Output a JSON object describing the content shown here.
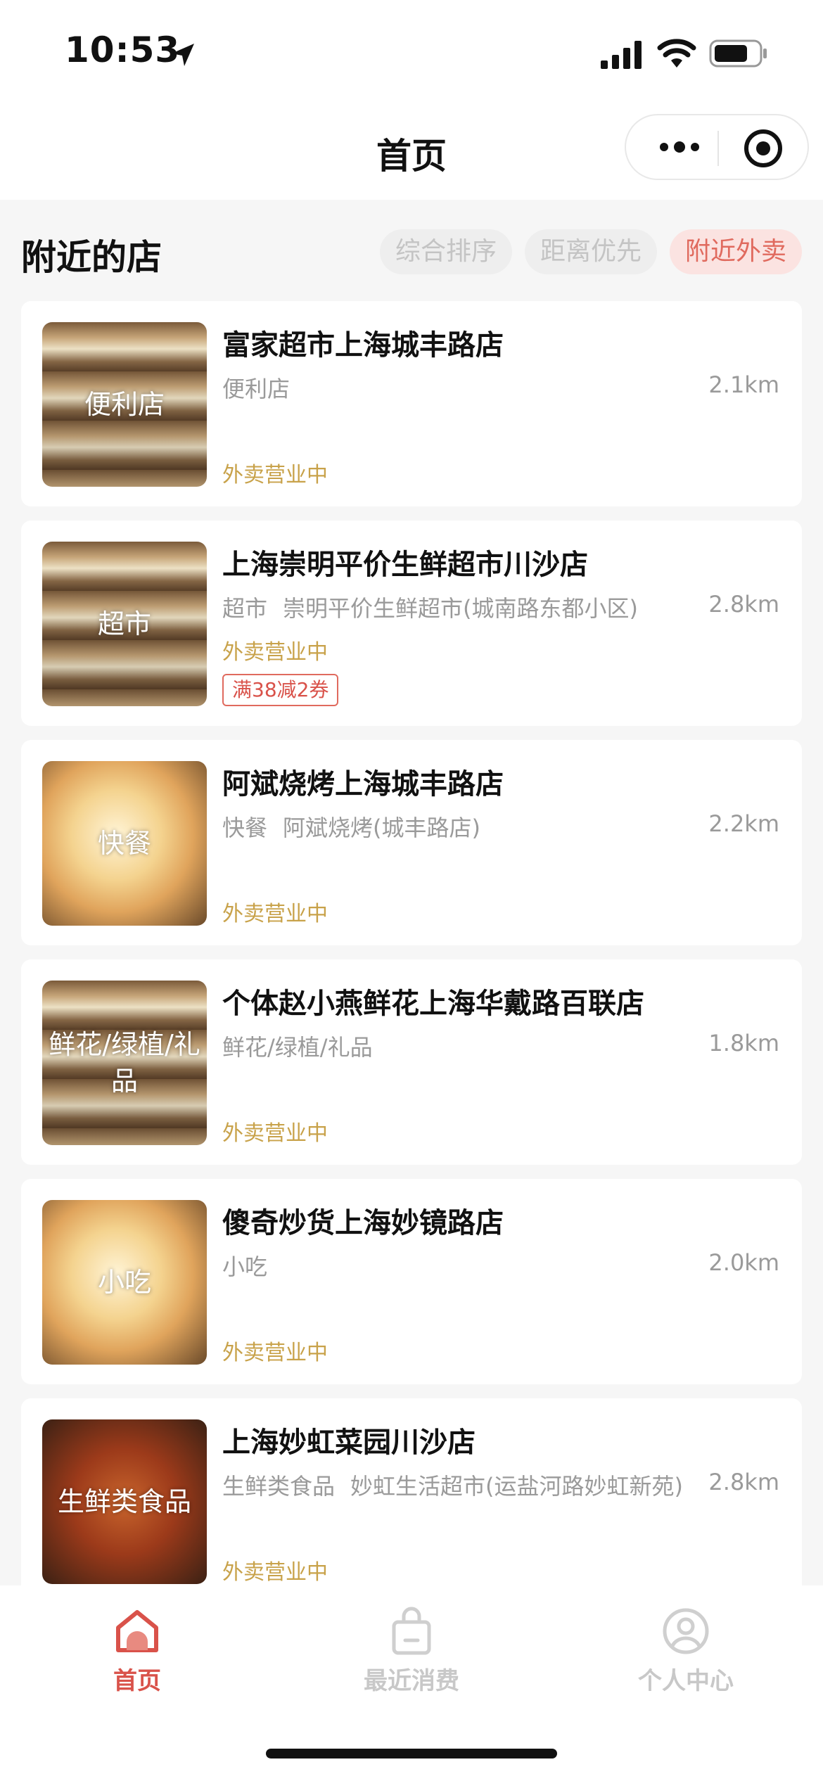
{
  "status_bar": {
    "time": "10:53"
  },
  "nav": {
    "title": "首页"
  },
  "section": {
    "title": "附近的店",
    "sort_options": [
      {
        "label": "综合排序",
        "active": false
      },
      {
        "label": "距离优先",
        "active": false
      },
      {
        "label": "附近外卖",
        "active": true
      }
    ]
  },
  "stores": [
    {
      "thumb_label": "便利店",
      "name": "富家超市上海城丰路店",
      "category": "便利店",
      "branch": "",
      "distance": "2.1km",
      "status": "外卖营业中",
      "coupon": ""
    },
    {
      "thumb_label": "超市",
      "name": "上海崇明平价生鲜超市川沙店",
      "category": "超市",
      "branch": "崇明平价生鲜超市(城南路东都小区)",
      "distance": "2.8km",
      "status": "外卖营业中",
      "coupon": "满38减2券"
    },
    {
      "thumb_label": "快餐",
      "name": "阿斌烧烤上海城丰路店",
      "category": "快餐",
      "branch": "阿斌烧烤(城丰路店)",
      "distance": "2.2km",
      "status": "外卖营业中",
      "coupon": ""
    },
    {
      "thumb_label": "鲜花/绿植/礼品",
      "name": "个体赵小燕鲜花上海华戴路百联店",
      "category": "鲜花/绿植/礼品",
      "branch": "",
      "distance": "1.8km",
      "status": "外卖营业中",
      "coupon": ""
    },
    {
      "thumb_label": "小吃",
      "name": "傻奇炒货上海妙镜路店",
      "category": "小吃",
      "branch": "",
      "distance": "2.0km",
      "status": "外卖营业中",
      "coupon": ""
    },
    {
      "thumb_label": "生鲜类食品",
      "name": "上海妙虹菜园川沙店",
      "category": "生鲜类食品",
      "branch": "妙虹生活超市(运盐河路妙虹新苑)",
      "distance": "2.8km",
      "status": "外卖营业中",
      "coupon": ""
    }
  ],
  "tab_bar": {
    "tabs": [
      {
        "label": "首页",
        "icon": "home-icon",
        "active": true
      },
      {
        "label": "最近消费",
        "icon": "shopping-bag-icon",
        "active": false
      },
      {
        "label": "个人中心",
        "icon": "user-icon",
        "active": false
      }
    ]
  },
  "colors": {
    "accent": "#d9524a",
    "open_status": "#c8a24a",
    "muted": "#9a9a9a"
  }
}
